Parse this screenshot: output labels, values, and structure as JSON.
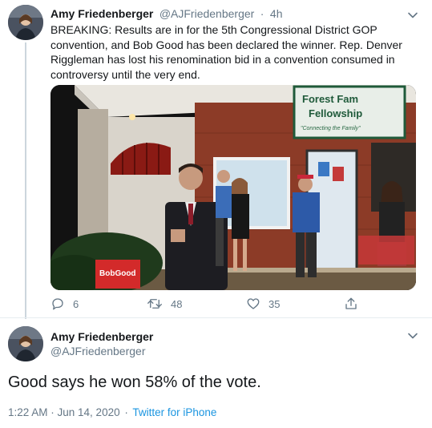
{
  "tweet1": {
    "display_name": "Amy Friedenberger",
    "handle": "@AJFriedenberger",
    "separator": "·",
    "time": "4h",
    "text": "BREAKING: Results are in for the 5th Congressional District GOP convention, and Bob Good has been declared the winner. Rep. Denver Riggleman has lost his renomination bid in a convention consumed in controversy until the very end.",
    "photo": {
      "sign_line1": "Forest Fam",
      "sign_line2": "Fellowship",
      "sign_line3": "\"Connecting the Family\"",
      "yard_sign": "BobGood"
    },
    "actions": {
      "reply_count": "6",
      "retweet_count": "48",
      "like_count": "35"
    }
  },
  "tweet2": {
    "display_name": "Amy Friedenberger",
    "handle": "@AJFriedenberger",
    "text": "Good says he won 58% of the vote.",
    "time": "1:22 AM · Jun 14, 2020",
    "separator": "·",
    "source": "Twitter for iPhone"
  },
  "colors": {
    "text": "#14171a",
    "muted": "#657786",
    "link": "#1b95e0",
    "divider": "#e6ecf0"
  }
}
